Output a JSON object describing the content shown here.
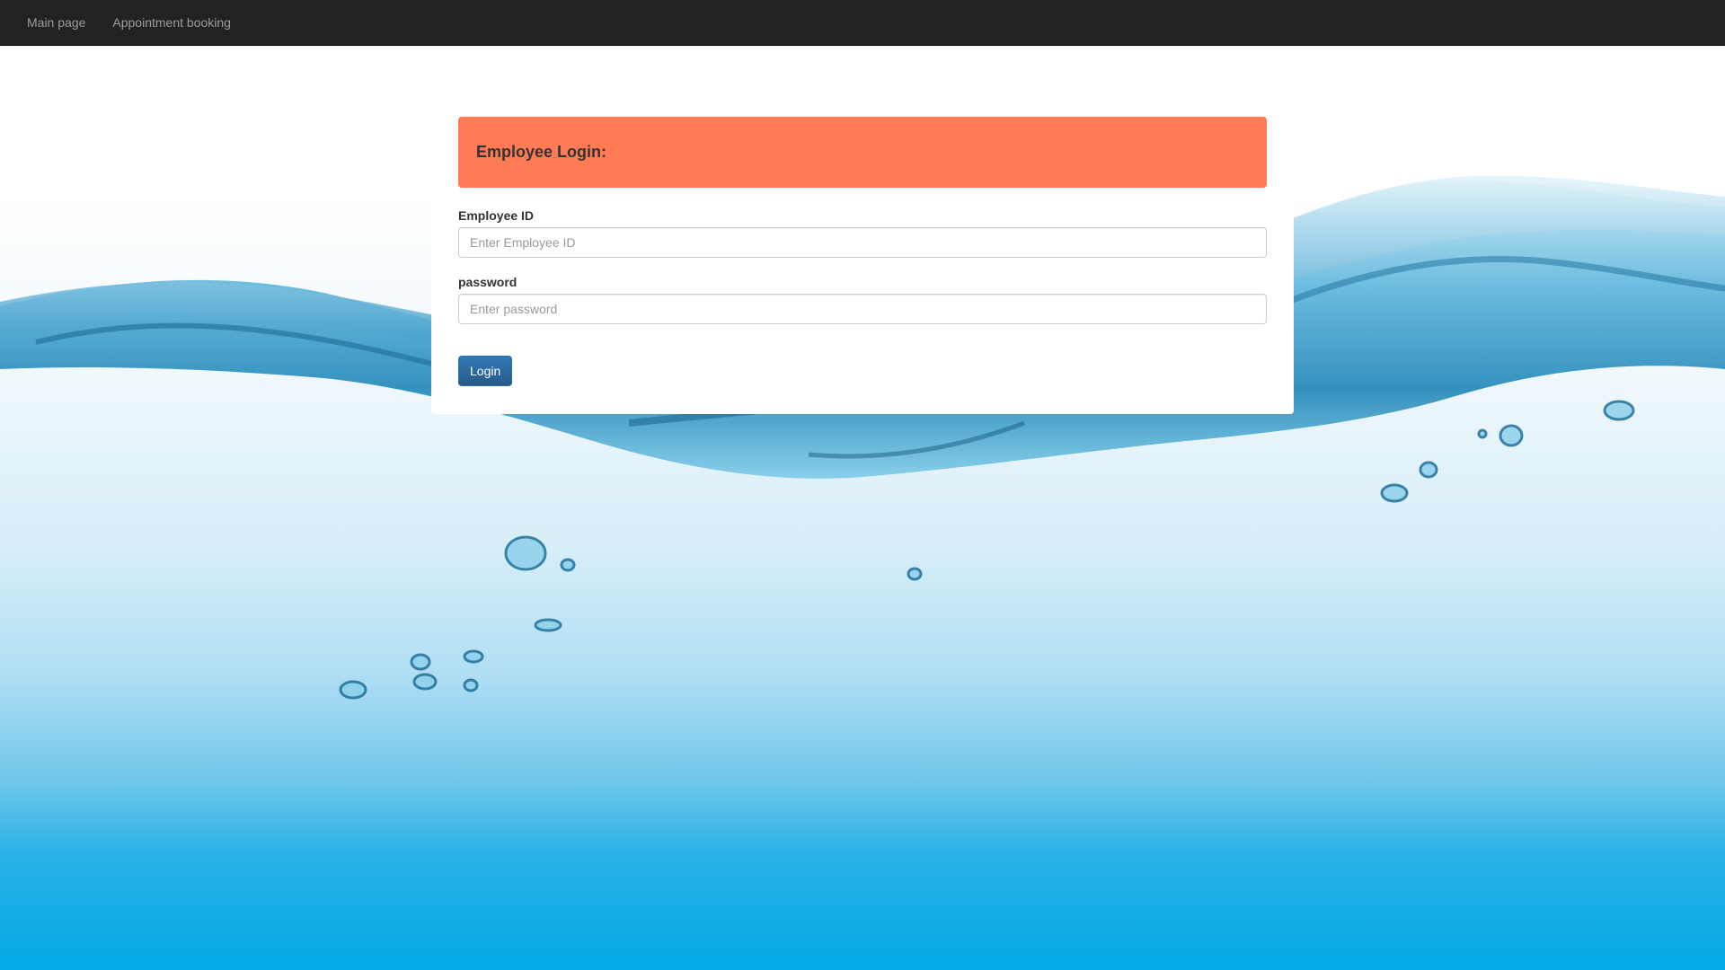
{
  "nav": {
    "items": [
      {
        "label": "Main page"
      },
      {
        "label": "Appointment booking"
      }
    ]
  },
  "login": {
    "title": "Employee Login:",
    "employee_id": {
      "label": "Employee ID",
      "placeholder": "Enter Employee ID",
      "value": ""
    },
    "password": {
      "label": "password",
      "placeholder": "Enter password",
      "value": ""
    },
    "submit_label": "Login"
  },
  "colors": {
    "navbar": "#222222",
    "header_accent": "#ff7b56",
    "button": "#337ab7",
    "water": "#03a9e6"
  },
  "background": {
    "description_icon": "water-splash-background"
  }
}
